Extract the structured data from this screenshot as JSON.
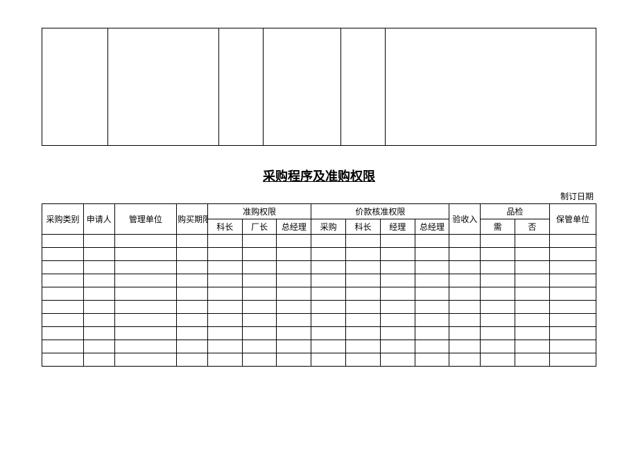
{
  "title": "采购程序及准购权限",
  "subtitle_right": "制订日期",
  "headers": {
    "category": "采购类别",
    "applicant": "申请人",
    "mgmt_unit": "管理单位",
    "buy_period": "购买期限",
    "approval_group": "准购权限",
    "approval": {
      "section_chief": "科长",
      "factory_chief": "厂长",
      "gm": "总经理"
    },
    "price_group": "价款核准权限",
    "price": {
      "purchase": "采购",
      "section_chief": "科长",
      "manager": "经理",
      "gm": "总经理"
    },
    "acceptance": "验收入",
    "qc_group": "品检",
    "qc": {
      "need": "需",
      "no": "否"
    },
    "custody_unit": "保管单位"
  },
  "chart_data": {
    "type": "table",
    "title": "采购程序及准购权限",
    "columns": [
      "采购类别",
      "申请人",
      "管理单位",
      "购买期限",
      "准购权限-科长",
      "准购权限-厂长",
      "准购权限-总经理",
      "价款核准权限-采购",
      "价款核准权限-科长",
      "价款核准权限-经理",
      "价款核准权限-总经理",
      "验收入",
      "品检-需",
      "品检-否",
      "保管单位"
    ],
    "rows": [
      [
        "",
        "",
        "",
        "",
        "",
        "",
        "",
        "",
        "",
        "",
        "",
        "",
        "",
        "",
        ""
      ],
      [
        "",
        "",
        "",
        "",
        "",
        "",
        "",
        "",
        "",
        "",
        "",
        "",
        "",
        "",
        ""
      ],
      [
        "",
        "",
        "",
        "",
        "",
        "",
        "",
        "",
        "",
        "",
        "",
        "",
        "",
        "",
        ""
      ],
      [
        "",
        "",
        "",
        "",
        "",
        "",
        "",
        "",
        "",
        "",
        "",
        "",
        "",
        "",
        ""
      ],
      [
        "",
        "",
        "",
        "",
        "",
        "",
        "",
        "",
        "",
        "",
        "",
        "",
        "",
        "",
        ""
      ],
      [
        "",
        "",
        "",
        "",
        "",
        "",
        "",
        "",
        "",
        "",
        "",
        "",
        "",
        "",
        ""
      ],
      [
        "",
        "",
        "",
        "",
        "",
        "",
        "",
        "",
        "",
        "",
        "",
        "",
        "",
        "",
        ""
      ],
      [
        "",
        "",
        "",
        "",
        "",
        "",
        "",
        "",
        "",
        "",
        "",
        "",
        "",
        "",
        ""
      ],
      [
        "",
        "",
        "",
        "",
        "",
        "",
        "",
        "",
        "",
        "",
        "",
        "",
        "",
        "",
        ""
      ],
      [
        "",
        "",
        "",
        "",
        "",
        "",
        "",
        "",
        "",
        "",
        "",
        "",
        "",
        "",
        ""
      ]
    ]
  }
}
